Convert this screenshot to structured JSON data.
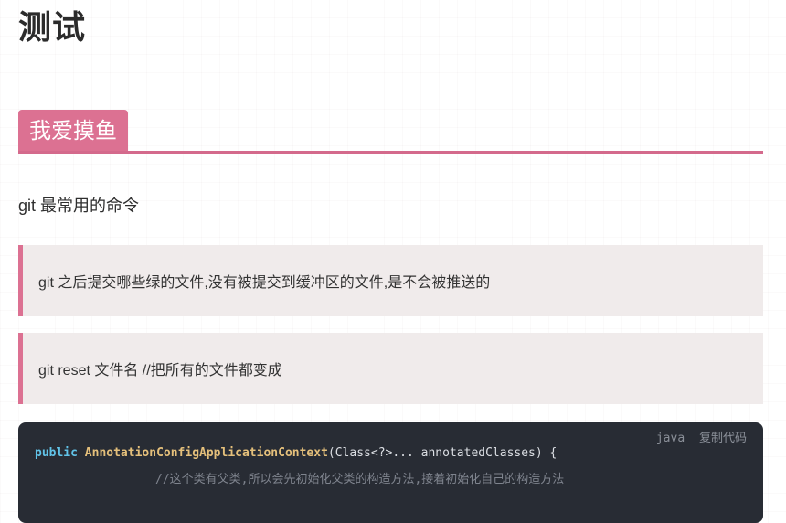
{
  "article": {
    "title": "测试",
    "section_heading": "我爱摸鱼",
    "paragraph": "git 最常用的命令",
    "quotes": [
      "git 之后提交哪些绿的文件,没有被提交到缓冲区的文件,是不会被推送的",
      "git reset 文件名 //把所有的文件都变成"
    ],
    "code_block": {
      "language": "java",
      "copy_label": "复制代码",
      "line1_keyword": "public",
      "line1_class": "AnnotationConfigApplicationContext",
      "line1_rest": "(Class<?>... annotatedClasses) {",
      "line2_comment": "//这个类有父类,所以会先初始化父类的构造方法,接着初始化自己的构造方法"
    }
  },
  "colors": {
    "accent": "#dc7192",
    "quote_background": "#f0ebeb",
    "code_background": "#282c34"
  }
}
